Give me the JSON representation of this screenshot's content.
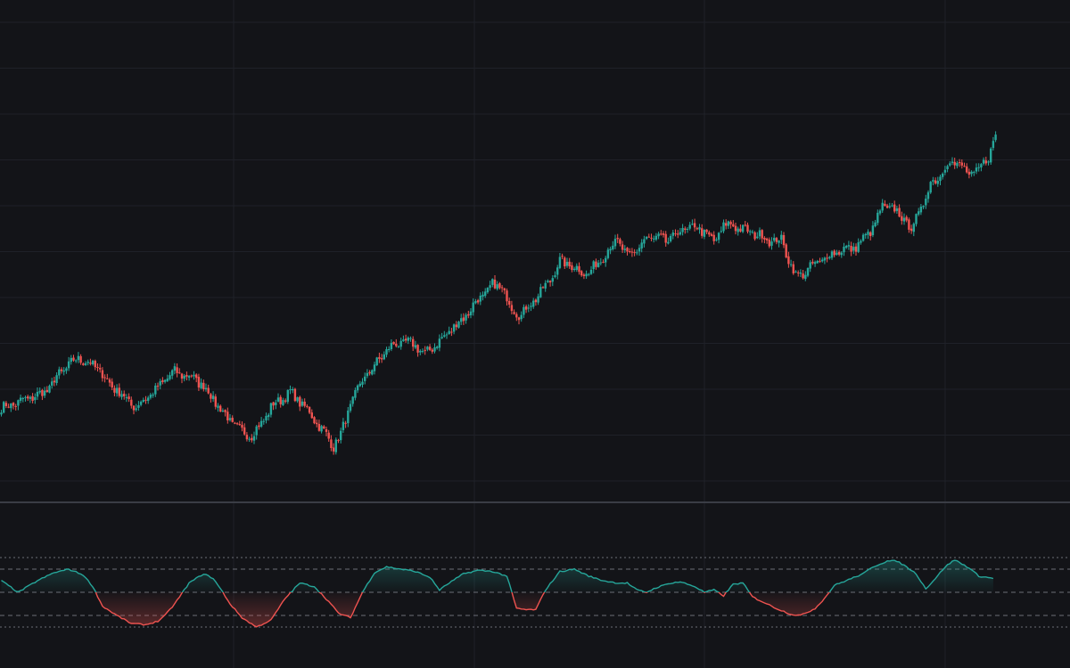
{
  "colors": {
    "background": "#131418",
    "grid": "#1f2128",
    "separator": "#3a3d45",
    "up": "#26a69a",
    "down": "#ef5350",
    "level_line": "#6b6e76"
  },
  "chart_data": [
    {
      "type": "candlestick",
      "name": "",
      "grid": true,
      "y_range": [
        0,
        100
      ],
      "close_path": [
        [
          0,
          12.6
        ],
        [
          4,
          13.6
        ],
        [
          8,
          14.4
        ],
        [
          12,
          15.5
        ],
        [
          16,
          16.3
        ],
        [
          20,
          18.2
        ],
        [
          24,
          22.0
        ],
        [
          28,
          24.4
        ],
        [
          32,
          26.4
        ],
        [
          36,
          25.0
        ],
        [
          40,
          23.7
        ],
        [
          44,
          20.0
        ],
        [
          48,
          17.6
        ],
        [
          52,
          15.0
        ],
        [
          56,
          12.7
        ],
        [
          60,
          15.6
        ],
        [
          64,
          17.3
        ],
        [
          68,
          20.6
        ],
        [
          72,
          22.5
        ],
        [
          76,
          21.7
        ],
        [
          80,
          20.9
        ],
        [
          84,
          18.7
        ],
        [
          88,
          15.2
        ],
        [
          92,
          11.5
        ],
        [
          96,
          8.5
        ],
        [
          100,
          6.1
        ],
        [
          104,
          5.2
        ],
        [
          108,
          8.4
        ],
        [
          112,
          12.9
        ],
        [
          116,
          15.0
        ],
        [
          120,
          16.9
        ],
        [
          124,
          14.4
        ],
        [
          128,
          11.4
        ],
        [
          132,
          7.8
        ],
        [
          136,
          4.2
        ],
        [
          138,
          2.3
        ],
        [
          141,
          5.4
        ],
        [
          145,
          13.5
        ],
        [
          150,
          20.4
        ],
        [
          155,
          24.2
        ],
        [
          160,
          28.5
        ],
        [
          164,
          30.3
        ],
        [
          168,
          30.6
        ],
        [
          172,
          30.0
        ],
        [
          176,
          27.2
        ],
        [
          180,
          30.0
        ],
        [
          184,
          32.0
        ],
        [
          188,
          35.2
        ],
        [
          192,
          37.2
        ],
        [
          196,
          40.9
        ],
        [
          200,
          43.4
        ],
        [
          204,
          46.3
        ],
        [
          208,
          45.6
        ],
        [
          212,
          39.8
        ],
        [
          216,
          38.1
        ],
        [
          220,
          41.4
        ],
        [
          224,
          44.3
        ],
        [
          228,
          47.8
        ],
        [
          232,
          52.7
        ],
        [
          236,
          52.0
        ],
        [
          240,
          50.3
        ],
        [
          244,
          49.4
        ],
        [
          248,
          52.7
        ],
        [
          252,
          55.9
        ],
        [
          256,
          58.8
        ],
        [
          260,
          53.8
        ],
        [
          264,
          56.2
        ],
        [
          268,
          59.0
        ],
        [
          272,
          59.4
        ],
        [
          276,
          58.2
        ],
        [
          280,
          60.2
        ],
        [
          284,
          61.5
        ],
        [
          288,
          62.2
        ],
        [
          292,
          61.0
        ],
        [
          296,
          57.9
        ],
        [
          300,
          62.7
        ],
        [
          304,
          62.8
        ],
        [
          308,
          61.4
        ],
        [
          312,
          60.6
        ],
        [
          316,
          59.7
        ],
        [
          320,
          58.3
        ],
        [
          324,
          58.7
        ],
        [
          328,
          51.8
        ],
        [
          330,
          48.7
        ],
        [
          334,
          50.0
        ],
        [
          338,
          52.1
        ],
        [
          342,
          53.6
        ],
        [
          346,
          55.4
        ],
        [
          350,
          56.1
        ],
        [
          354,
          56.4
        ],
        [
          358,
          58.8
        ],
        [
          362,
          62.1
        ],
        [
          366,
          67.7
        ],
        [
          370,
          67.3
        ],
        [
          374,
          65.1
        ],
        [
          378,
          61.7
        ],
        [
          382,
          67.3
        ],
        [
          386,
          74.1
        ],
        [
          390,
          76.5
        ],
        [
          394,
          80.4
        ],
        [
          398,
          79.2
        ],
        [
          402,
          76.6
        ],
        [
          406,
          77.6
        ],
        [
          410,
          81.8
        ],
        [
          413,
          87.2
        ]
      ]
    },
    {
      "type": "area",
      "name": "",
      "y_range": [
        0,
        100
      ],
      "levels": [
        80,
        70,
        50,
        30,
        20
      ],
      "baseline": 50,
      "values_path": [
        [
          0,
          60
        ],
        [
          7,
          50
        ],
        [
          15,
          60
        ],
        [
          22,
          67
        ],
        [
          28,
          70
        ],
        [
          34,
          65
        ],
        [
          38,
          55
        ],
        [
          42,
          38
        ],
        [
          48,
          30
        ],
        [
          54,
          23
        ],
        [
          60,
          22
        ],
        [
          65,
          25
        ],
        [
          68,
          30
        ],
        [
          72,
          40
        ],
        [
          78,
          58
        ],
        [
          84,
          66
        ],
        [
          88,
          62
        ],
        [
          92,
          50
        ],
        [
          95,
          40
        ],
        [
          100,
          28
        ],
        [
          106,
          20
        ],
        [
          112,
          26
        ],
        [
          118,
          45
        ],
        [
          124,
          58
        ],
        [
          130,
          55
        ],
        [
          136,
          42
        ],
        [
          140,
          32
        ],
        [
          145,
          28
        ],
        [
          150,
          50
        ],
        [
          155,
          67
        ],
        [
          160,
          72
        ],
        [
          166,
          70
        ],
        [
          172,
          68
        ],
        [
          178,
          63
        ],
        [
          182,
          52
        ],
        [
          186,
          58
        ],
        [
          192,
          66
        ],
        [
          198,
          69
        ],
        [
          204,
          68
        ],
        [
          210,
          64
        ],
        [
          214,
          36
        ],
        [
          218,
          35
        ],
        [
          222,
          35
        ],
        [
          226,
          52
        ],
        [
          232,
          68
        ],
        [
          238,
          70
        ],
        [
          244,
          64
        ],
        [
          250,
          60
        ],
        [
          256,
          58
        ],
        [
          260,
          58
        ],
        [
          264,
          52
        ],
        [
          268,
          50
        ],
        [
          272,
          54
        ],
        [
          278,
          58
        ],
        [
          282,
          59
        ],
        [
          288,
          55
        ],
        [
          292,
          50
        ],
        [
          296,
          52
        ],
        [
          300,
          47
        ],
        [
          304,
          57
        ],
        [
          308,
          58
        ],
        [
          312,
          46
        ],
        [
          316,
          42
        ],
        [
          322,
          36
        ],
        [
          328,
          31
        ],
        [
          332,
          30
        ],
        [
          338,
          36
        ],
        [
          342,
          45
        ],
        [
          346,
          56
        ],
        [
          352,
          61
        ],
        [
          358,
          66
        ],
        [
          362,
          72
        ],
        [
          368,
          77
        ],
        [
          372,
          77
        ],
        [
          376,
          72
        ],
        [
          380,
          66
        ],
        [
          384,
          53
        ],
        [
          388,
          62
        ],
        [
          392,
          72
        ],
        [
          396,
          78
        ],
        [
          402,
          71
        ],
        [
          406,
          64
        ],
        [
          412,
          62
        ]
      ]
    }
  ]
}
